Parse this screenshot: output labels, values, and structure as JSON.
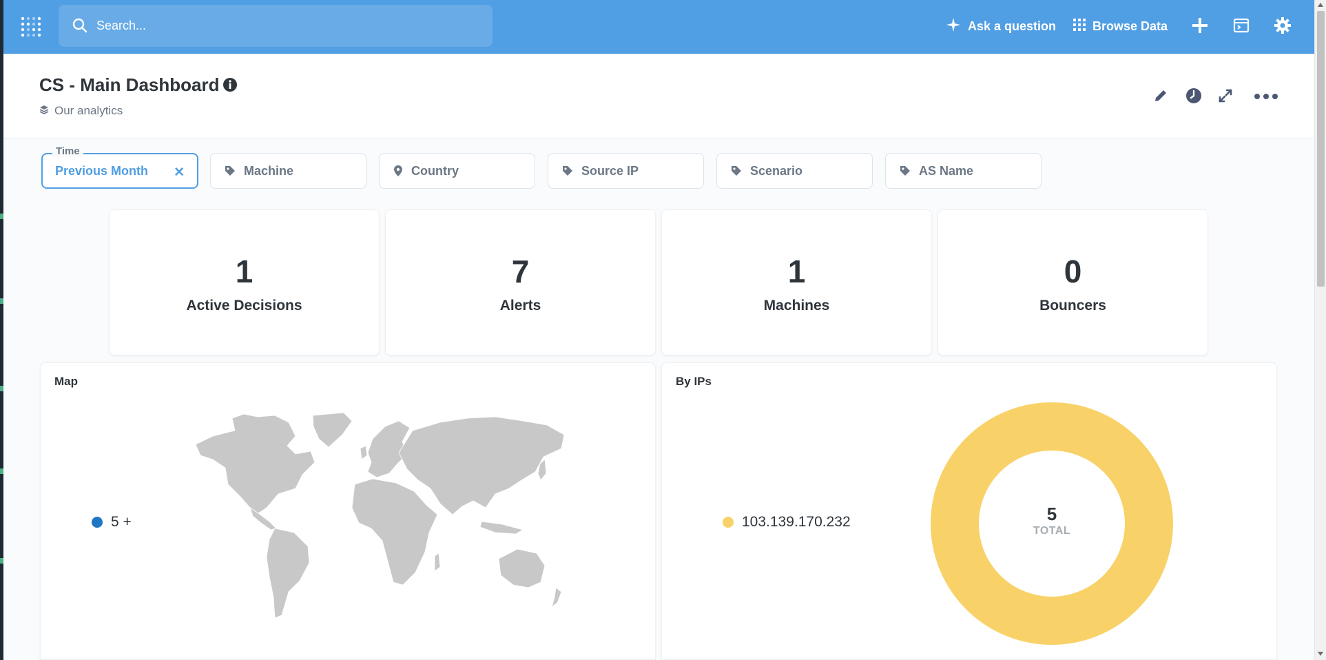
{
  "topbar": {
    "search_placeholder": "Search...",
    "ask_label": "Ask a question",
    "browse_label": "Browse Data",
    "icons": [
      "metabase-logo-icon",
      "search-icon",
      "sparkle-icon",
      "grid-icon",
      "plus-icon",
      "sql-editor-icon",
      "gear-icon"
    ]
  },
  "header": {
    "title": "CS - Main Dashboard",
    "collection": "Our analytics"
  },
  "filters": {
    "time": {
      "caption": "Time",
      "value": "Previous Month"
    },
    "items": [
      {
        "label": "Machine",
        "icon": "tag-icon"
      },
      {
        "label": "Country",
        "icon": "location-icon"
      },
      {
        "label": "Source IP",
        "icon": "tag-icon"
      },
      {
        "label": "Scenario",
        "icon": "tag-icon"
      },
      {
        "label": "AS Name",
        "icon": "tag-icon"
      }
    ]
  },
  "scalars": [
    {
      "value": "1",
      "label": "Active Decisions"
    },
    {
      "value": "7",
      "label": "Alerts"
    },
    {
      "value": "1",
      "label": "Machines"
    },
    {
      "value": "0",
      "label": "Bouncers"
    }
  ],
  "map": {
    "title": "Map",
    "legend": "5 +",
    "legend_color": "#1f77c4",
    "land_color": "#c8c8c8"
  },
  "by_ips": {
    "title": "By IPs",
    "legend": "103.139.170.232",
    "color": "#f8d269",
    "total": "5",
    "total_label": "TOTAL"
  },
  "chart_data": [
    {
      "type": "pie",
      "title": "By IPs",
      "categories": [
        "103.139.170.232"
      ],
      "values": [
        5
      ],
      "total": 5
    }
  ],
  "colors": {
    "brand": "#509ee3",
    "text": "#2e353b",
    "muted": "#6b7785"
  }
}
